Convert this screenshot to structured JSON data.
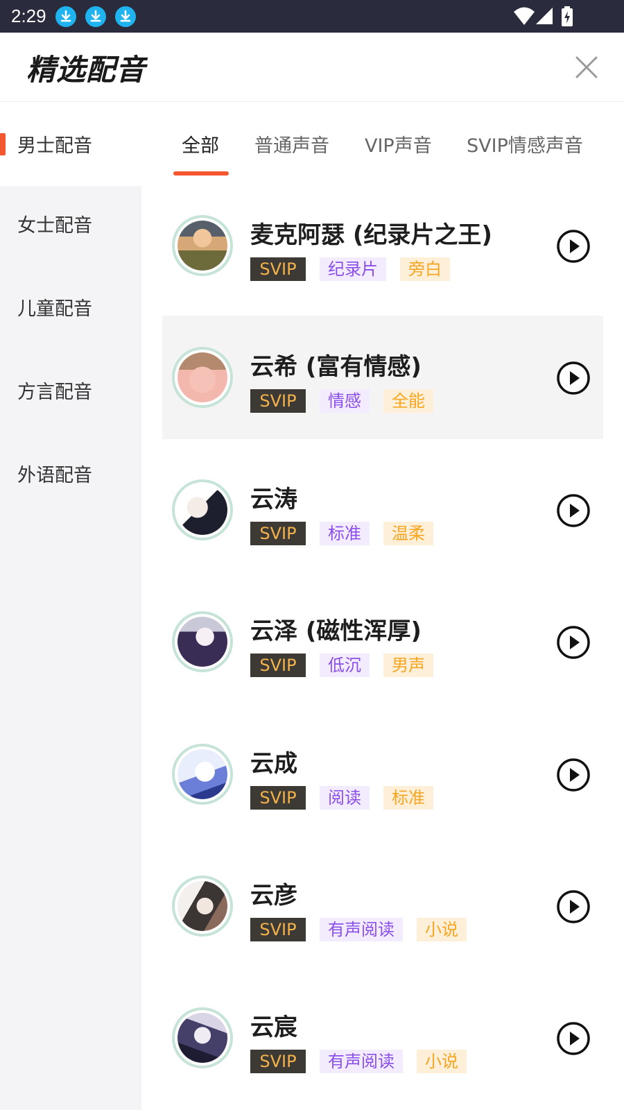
{
  "status_bar": {
    "time": "2:29",
    "icons": [
      "download-icon",
      "download-icon",
      "download-icon",
      "wifi-icon",
      "signal-icon",
      "battery-charging-icon"
    ]
  },
  "header": {
    "title": "精选配音",
    "close_icon": "close-icon"
  },
  "sidebar": {
    "items": [
      {
        "label": "男士配音",
        "active": true
      },
      {
        "label": "女士配音",
        "active": false
      },
      {
        "label": "儿童配音",
        "active": false
      },
      {
        "label": "方言配音",
        "active": false
      },
      {
        "label": "外语配音",
        "active": false
      }
    ]
  },
  "tabs": [
    {
      "label": "全部",
      "active": true
    },
    {
      "label": "普通声音",
      "active": false
    },
    {
      "label": "VIP声音",
      "active": false
    },
    {
      "label": "SVIP情感声音",
      "active": false
    }
  ],
  "voices": [
    {
      "name": "麦克阿瑟 (纪录片之王)",
      "tags": [
        "SVIP",
        "纪录片",
        "旁白"
      ],
      "highlighted": false
    },
    {
      "name": "云希 (富有情感)",
      "tags": [
        "SVIP",
        "情感",
        "全能"
      ],
      "highlighted": true
    },
    {
      "name": "云涛",
      "tags": [
        "SVIP",
        "标准",
        "温柔"
      ],
      "highlighted": false
    },
    {
      "name": "云泽 (磁性浑厚)",
      "tags": [
        "SVIP",
        "低沉",
        "男声"
      ],
      "highlighted": false
    },
    {
      "name": "云成",
      "tags": [
        "SVIP",
        "阅读",
        "标准"
      ],
      "highlighted": false
    },
    {
      "name": "云彦",
      "tags": [
        "SVIP",
        "有声阅读",
        "小说"
      ],
      "highlighted": false
    },
    {
      "name": "云宸",
      "tags": [
        "SVIP",
        "有声阅读",
        "小说"
      ],
      "highlighted": false
    }
  ],
  "colors": {
    "accent": "#f2572f",
    "status_bar_bg": "#2a2b3d",
    "sidebar_bg": "#f4f4f7",
    "svip_tag_bg": "#3d3a36",
    "svip_tag_text": "#f4b24a",
    "purple_tag_bg": "#f3ecfe",
    "purple_tag_text": "#8a4fe8",
    "orange_tag_bg": "#fdefd8",
    "orange_tag_text": "#f5a623",
    "avatar_ring": "#c6e3d8"
  }
}
